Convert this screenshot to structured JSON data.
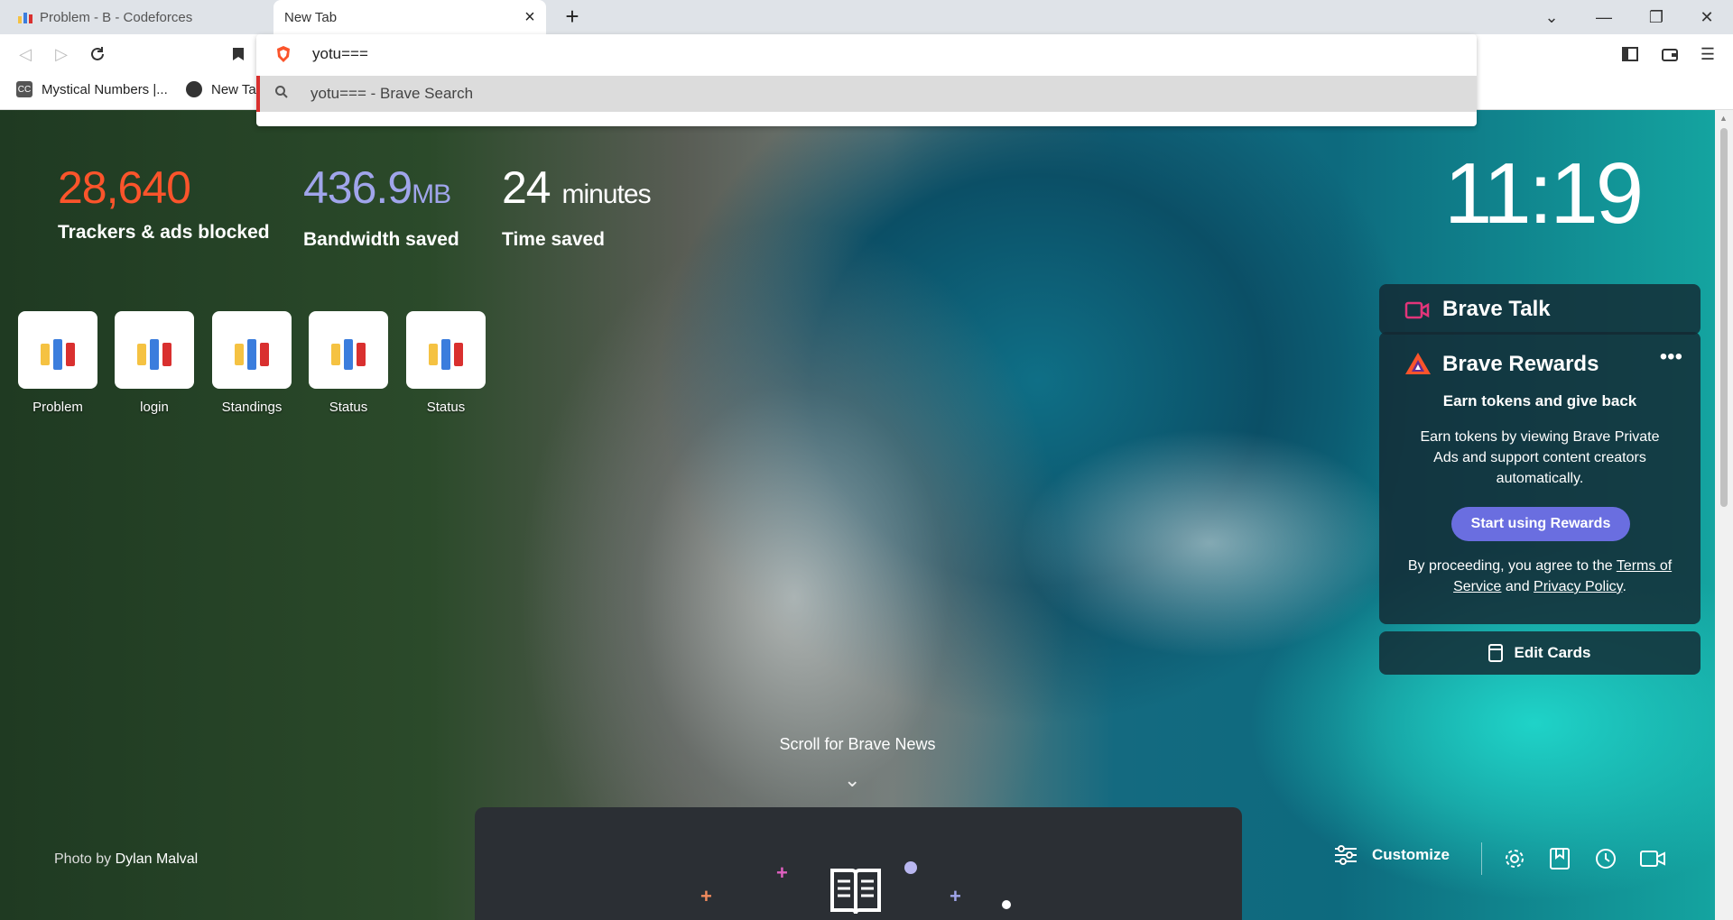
{
  "tabs": [
    {
      "title": "Problem - B - Codeforces"
    },
    {
      "title": "New Tab"
    }
  ],
  "omnibox": {
    "input": "yotu===",
    "suggestion": "yotu=== - Brave Search"
  },
  "bookmarks": [
    {
      "label": "Mystical Numbers |..."
    },
    {
      "label": "New Ta"
    }
  ],
  "stats": {
    "trackers": {
      "value": "28,640",
      "label": "Trackers & ads blocked",
      "color": "#fb542b"
    },
    "bandwidth": {
      "value": "436.9",
      "unit": "MB",
      "label": "Bandwidth saved",
      "color": "#a0a5eb"
    },
    "time": {
      "value": "24",
      "unit": "minutes",
      "label": "Time saved"
    }
  },
  "clock": "11:19",
  "top_sites": [
    {
      "label": "Problem"
    },
    {
      "label": "login"
    },
    {
      "label": "Standings"
    },
    {
      "label": "Status"
    },
    {
      "label": "Status"
    }
  ],
  "brave_talk": {
    "title": "Brave Talk"
  },
  "brave_rewards": {
    "title": "Brave Rewards",
    "more": "•••",
    "heading": "Earn tokens and give back",
    "body": "Earn tokens by viewing Brave Private Ads and support content creators automatically.",
    "button": "Start using Rewards",
    "terms_prefix": "By proceeding, you agree to the ",
    "terms_link": "Terms of Service",
    "terms_and": " and ",
    "privacy_link": "Privacy Policy",
    "terms_suffix": "."
  },
  "edit_cards": "Edit Cards",
  "photo_credit": {
    "prefix": "Photo by ",
    "name": "Dylan Malval"
  },
  "scroll_news": "Scroll for Brave News",
  "customize": "Customize",
  "icons": {
    "shield": "brave-shield-icon",
    "search": "search-icon"
  },
  "colors": {
    "accent": "#6a6ee0",
    "brave_orange": "#fb542b",
    "talk_pink": "#e2357a"
  }
}
